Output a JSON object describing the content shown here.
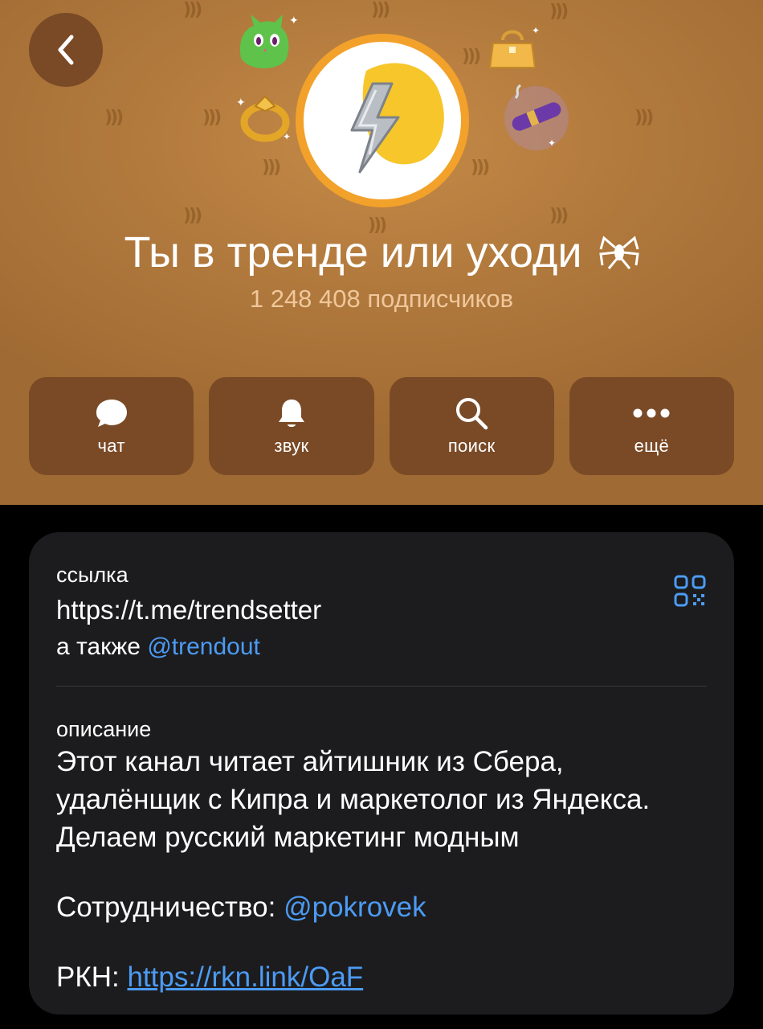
{
  "header": {
    "channel_title": "Ты в тренде или уходи",
    "subscribers": "1 248 408 подписчиков",
    "colors": {
      "background": "#b27a3d",
      "button": "#7a4a26",
      "ring": "#f2a12a",
      "subtitle": "#f0c79b"
    }
  },
  "actions": [
    {
      "label": "чат",
      "icon": "chat-bubble-icon"
    },
    {
      "label": "звук",
      "icon": "bell-icon"
    },
    {
      "label": "поиск",
      "icon": "search-icon"
    },
    {
      "label": "ещё",
      "icon": "more-dots-icon"
    }
  ],
  "info": {
    "link_label": "ссылка",
    "link_url": "https://t.me/trendsetter",
    "also_prefix": "а также",
    "also_handle": "@trendout",
    "description_label": "описание",
    "description_lines": [
      "Этот канал читает айтишник из Сбера,",
      "удалёнщик с Кипра и маркетолог из Яндекса.",
      "Делаем русский маркетинг модным"
    ],
    "cooperation_prefix": "Сотрудничество:",
    "cooperation_handle": "@pokrovek",
    "rkn_prefix": "РКН:",
    "rkn_link": "https://rkn.link/OaF",
    "colors": {
      "card": "#1c1c1e",
      "link": "#4c9bf3"
    }
  }
}
